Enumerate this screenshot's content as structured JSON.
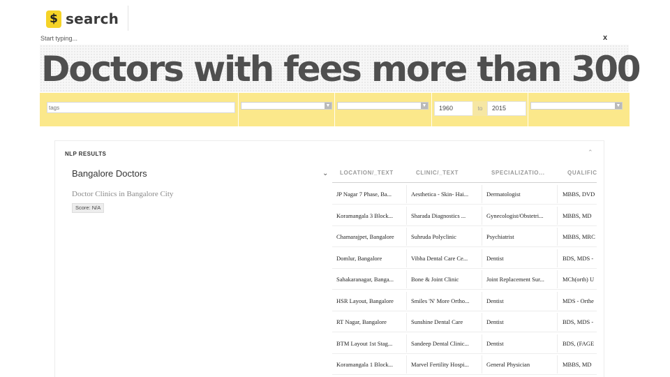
{
  "header": {
    "logo_glyph": "$",
    "logo_text": "search",
    "typing_hint": "Start typing...",
    "close_label": "x"
  },
  "query": {
    "title": "Doctors with fees more than 300"
  },
  "filters": {
    "tags_placeholder": "tags",
    "year_from": "1960",
    "year_to_label": "to",
    "year_to": "2015",
    "accent_color": "#fbe88b"
  },
  "results": {
    "section_label": "NLP RESULTS",
    "collapse_icon": "chevron-up-icon",
    "group_title": "Bangalore Doctors",
    "group_subtitle": "Doctor Clinics in Bangalore City",
    "score": "Score: N/A",
    "columns": [
      "LOCATION/_TEXT",
      "CLINIC/_TEXT",
      "SPECIALIZATIO...",
      "QUALIFIC"
    ],
    "rows": [
      [
        "JP Nagar 7 Phase, Ba...",
        "Aesthetica - Skin- Hai...",
        "Dermatologist",
        "MBBS, DVD"
      ],
      [
        "Koramangala 3 Block...",
        "Sharada Diagnostics ...",
        "Gynecologist/Obstetri...",
        "MBBS, MD"
      ],
      [
        "Chamarajpet, Bangalore",
        "Suhruda Polyclinic",
        "Psychiatrist",
        "MBBS, MRC"
      ],
      [
        "Domlur, Bangalore",
        "Vibha Dental Care Ce...",
        "Dentist",
        "BDS, MDS -"
      ],
      [
        "Sahakaranagar, Banga...",
        "Bone & Joint Clinic",
        "Joint Replacement Sur...",
        "MCh(orth) U"
      ],
      [
        "HSR Layout, Bangalore",
        "Smiles 'N' More Ortho...",
        "Dentist",
        "MDS - Orthe"
      ],
      [
        "RT Nagar, Bangalore",
        "Sunshine Dental Care",
        "Dentist",
        "BDS, MDS -"
      ],
      [
        "BTM Layout 1st Stag...",
        "Sandeep Dental Clinic...",
        "Dentist",
        "BDS, (FAGE"
      ],
      [
        "Koramangala 1 Block...",
        "Marvel Fertility Hospi...",
        "General Physician",
        "MBBS, MD"
      ]
    ]
  }
}
